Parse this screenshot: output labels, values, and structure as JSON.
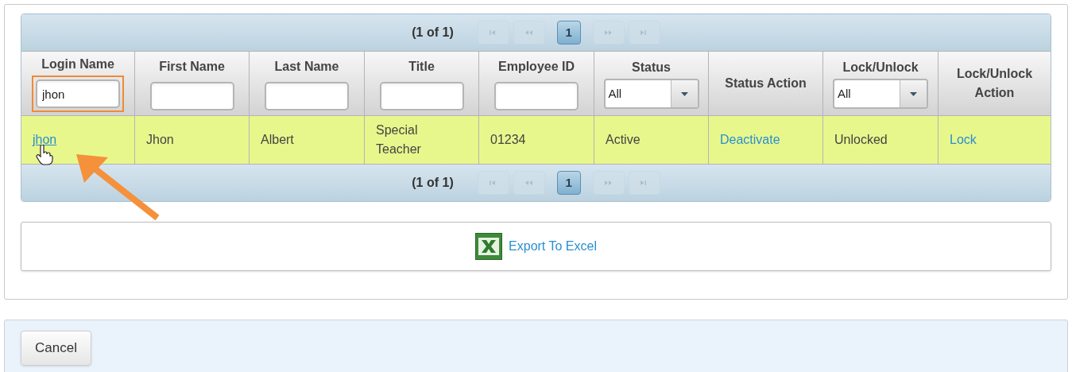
{
  "table": {
    "pager_top": {
      "summary": "(1 of 1)",
      "nav": [
        {
          "kind": "first",
          "disabled": true
        },
        {
          "kind": "prev",
          "disabled": true
        },
        {
          "kind": "page",
          "label": "1",
          "selected": true
        },
        {
          "kind": "next",
          "disabled": true
        },
        {
          "kind": "last",
          "disabled": true
        }
      ]
    },
    "columns": [
      {
        "label": "Login Name",
        "filter": {
          "kind": "text",
          "value": "jhon",
          "highlighted": true
        }
      },
      {
        "label": "First Name",
        "filter": {
          "kind": "text",
          "highlighted": false
        }
      },
      {
        "label": "Last Name",
        "filter": {
          "kind": "text",
          "highlighted": false
        }
      },
      {
        "label": "Title",
        "filter": {
          "kind": "text",
          "highlighted": false
        }
      },
      {
        "label": "Employee ID",
        "filter": {
          "kind": "text",
          "highlighted": false
        }
      },
      {
        "label": "Status",
        "filter": {
          "kind": "select",
          "value": "All"
        }
      },
      {
        "label": "Status Action"
      },
      {
        "label": "Lock/Unlock",
        "filter": {
          "kind": "select",
          "value": "All"
        }
      },
      {
        "label": "Lock/Unlock Action"
      }
    ],
    "rows": [
      {
        "highlighted": true,
        "cells": [
          {
            "kind": "link",
            "text": "jhon",
            "hovered": true
          },
          {
            "kind": "text",
            "text": "Jhon"
          },
          {
            "kind": "text",
            "text": "Albert"
          },
          {
            "kind": "text",
            "text": "Special Teacher"
          },
          {
            "kind": "text",
            "text": "01234"
          },
          {
            "kind": "text",
            "text": "Active"
          },
          {
            "kind": "link",
            "text": "Deactivate"
          },
          {
            "kind": "text",
            "text": "Unlocked"
          },
          {
            "kind": "link",
            "text": "Lock"
          }
        ]
      }
    ],
    "pager_bottom": {
      "summary": "(1 of 1)",
      "nav": [
        {
          "kind": "first",
          "disabled": true
        },
        {
          "kind": "prev",
          "disabled": true
        },
        {
          "kind": "page",
          "label": "1",
          "selected": true
        },
        {
          "kind": "next",
          "disabled": true
        },
        {
          "kind": "last",
          "disabled": true
        }
      ]
    }
  },
  "export": {
    "label": "Export To Excel"
  },
  "footer": {
    "buttons": [
      {
        "label": "Cancel"
      }
    ]
  }
}
